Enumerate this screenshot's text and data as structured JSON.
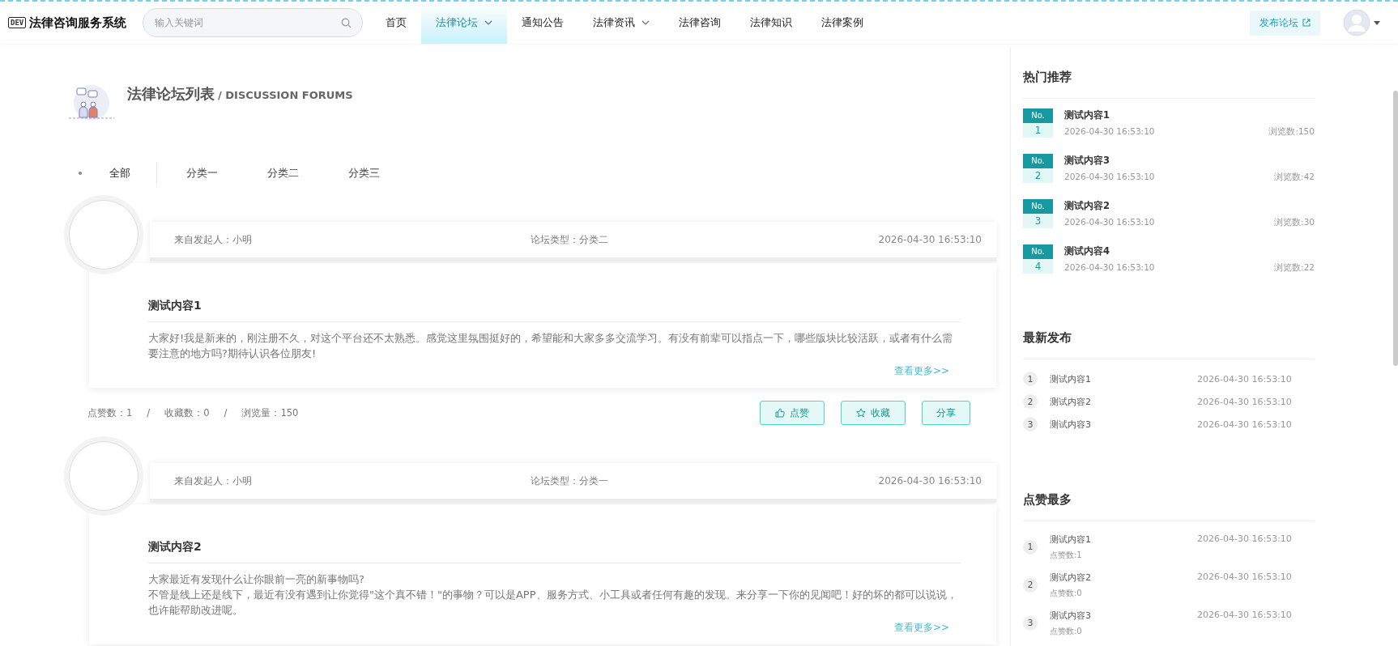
{
  "header": {
    "logo_badge": "DEV",
    "site_title": "法律咨询服务系统",
    "search": {
      "placeholder": "输入关键词"
    },
    "nav": [
      {
        "label": "首页",
        "selected": false,
        "dropdown": false
      },
      {
        "label": "法律论坛",
        "selected": true,
        "dropdown": true
      },
      {
        "label": "通知公告",
        "selected": false,
        "dropdown": false
      },
      {
        "label": "法律资讯",
        "selected": false,
        "dropdown": true
      },
      {
        "label": "法律咨询",
        "selected": false,
        "dropdown": false
      },
      {
        "label": "法律知识",
        "selected": false,
        "dropdown": false
      },
      {
        "label": "法律案例",
        "selected": false,
        "dropdown": false
      }
    ],
    "publish_button": "发布论坛"
  },
  "page_heading": {
    "title": "法律论坛列表",
    "subtitle": "/ DISCUSSION FORUMS"
  },
  "categories": [
    {
      "label": "全部",
      "selected": true
    },
    {
      "label": "分类一",
      "selected": false
    },
    {
      "label": "分类二",
      "selected": false
    },
    {
      "label": "分类三",
      "selected": false
    }
  ],
  "posts": [
    {
      "author": "来自发起人：小明",
      "type": "论坛类型：分类二",
      "time": "2026-04-30 16:53:10",
      "title": "测试内容1",
      "content": [
        "大家好!我是新来的，刚注册不久，对这个平台还不太熟悉。感觉这里氛围挺好的，希望能和大家多多交流学习。有没有前辈可以指点一下，哪些版块比较活跃，或者有什么需要注意的地方吗?期待认识各位朋友!"
      ],
      "more": "查看更多>>",
      "likes": "点赞数：1",
      "favorites": "收藏数：0",
      "views": "浏览量：150",
      "separator": "/",
      "like_button": "点赞",
      "favorite_button": "收藏",
      "share_button": "分享"
    },
    {
      "author": "来自发起人：小明",
      "type": "论坛类型：分类一",
      "time": "2026-04-30 16:53:10",
      "title": "测试内容2",
      "content": [
        "大家最近有发现什么让你眼前一亮的新事物吗?",
        "不管是线上还是线下，最近有没有遇到让你觉得\"这个真不错！\"的事物？可以是APP、服务方式、小工具或者任何有趣的发现。来分享一下你的见闻吧！好的坏的都可以说说，也许能帮助改进呢。"
      ],
      "more": "查看更多>>"
    }
  ],
  "sidebar": {
    "hot": {
      "title": "热门推荐",
      "items": [
        {
          "badge": "No.",
          "rank": "1",
          "title": "测试内容1",
          "time": "2026-04-30 16:53:10",
          "views": "浏览数:150"
        },
        {
          "badge": "No.",
          "rank": "2",
          "title": "测试内容3",
          "time": "2026-04-30 16:53:10",
          "views": "浏览数:42"
        },
        {
          "badge": "No.",
          "rank": "3",
          "title": "测试内容2",
          "time": "2026-04-30 16:53:10",
          "views": "浏览数:30"
        },
        {
          "badge": "No.",
          "rank": "4",
          "title": "测试内容4",
          "time": "2026-04-30 16:53:10",
          "views": "浏览数:22"
        }
      ]
    },
    "latest": {
      "title": "最新发布",
      "items": [
        {
          "rank": "1",
          "title": "测试内容1",
          "time": "2026-04-30 16:53:10"
        },
        {
          "rank": "2",
          "title": "测试内容2",
          "time": "2026-04-30 16:53:10"
        },
        {
          "rank": "3",
          "title": "测试内容3",
          "time": "2026-04-30 16:53:10"
        }
      ]
    },
    "most_liked": {
      "title": "点赞最多",
      "items": [
        {
          "rank": "1",
          "title": "测试内容1",
          "time": "2026-04-30 16:53:10",
          "likes": "点赞数:1"
        },
        {
          "rank": "2",
          "title": "测试内容2",
          "time": "2026-04-30 16:53:10",
          "likes": "点赞数:0"
        },
        {
          "rank": "3",
          "title": "测试内容3",
          "time": "2026-04-30 16:53:10",
          "likes": "点赞数:0"
        }
      ]
    }
  }
}
